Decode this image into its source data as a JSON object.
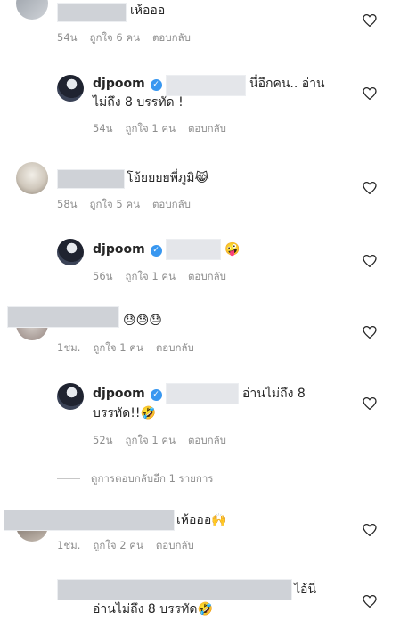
{
  "comments": [
    {
      "text": "เห้อออ",
      "time": "54น",
      "likes": "ถูกใจ 6 คน",
      "reply": "ตอบกลับ"
    },
    {
      "user": "djpoom",
      "text": "นี่อีกคน.. อ่าน",
      "text2": "ไม่ถึง 8 บรรทัด !",
      "time": "54น",
      "likes": "ถูกใจ 1 คน",
      "reply": "ตอบกลับ"
    },
    {
      "text": "โอ้ยยยยพี่ภูมิ",
      "emoji": "😹",
      "time": "58น",
      "likes": "ถูกใจ 5 คน",
      "reply": "ตอบกลับ"
    },
    {
      "user": "djpoom",
      "text": "(",
      "emoji": "🤪",
      "time": "56น",
      "likes": "ถูกใจ 1 คน",
      "reply": "ตอบกลับ"
    },
    {
      "emoji": "😓😓😓",
      "time": "1ชม.",
      "likes": "ถูกใจ 1 คน",
      "reply": "ตอบกลับ"
    },
    {
      "user": "djpoom",
      "text": "อ่านไม่ถึง 8",
      "text2": "บรรทัด!!",
      "emoji": "🤣",
      "time": "52น",
      "likes": "ถูกใจ 1 คน",
      "reply": "ตอบกลับ"
    },
    {
      "text": "เห้อออ",
      "emoji": "🙌",
      "time": "1ชม.",
      "likes": "ถูกใจ 2 คน",
      "reply": "ตอบกลับ"
    },
    {
      "text": "ไอ้นี่",
      "text2": "อ่านไม่ถึง 8 บรรทัด",
      "emoji": "🤣"
    }
  ],
  "view_more": "ดูการตอบกลับอีก 1 รายการ",
  "icons": {
    "heart": "heart-outline-icon",
    "verified": "verified-badge-icon"
  },
  "colors": {
    "text": "#262626",
    "meta": "#8e8e8e",
    "verified": "#3897f0"
  }
}
